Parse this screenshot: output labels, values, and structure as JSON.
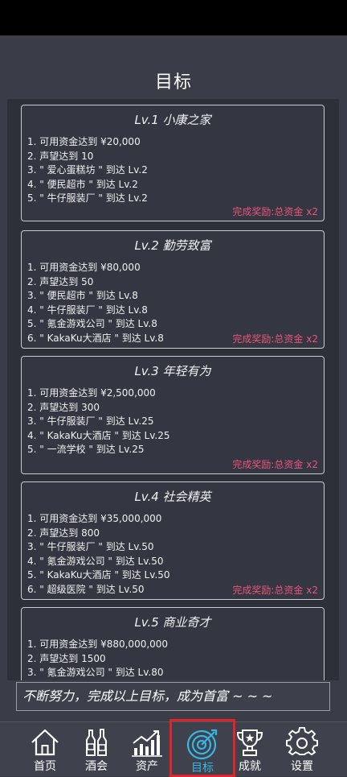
{
  "page_title": "目标",
  "goals": [
    {
      "title": "Lv.1 小康之家",
      "requirements": [
        "1. 可用资金达到 ¥20,000",
        "2. 声望达到 10",
        "3. \" 爱心蛋糕坊 \" 到达 Lv.2",
        "4. \" 便民超市 \" 到达 Lv.2",
        "5. \" 牛仔服装厂 \" 到达 Lv.2"
      ],
      "reward": "完成奖励:总资金 x2"
    },
    {
      "title": "Lv.2 勤劳致富",
      "requirements": [
        "1. 可用资金达到 ¥80,000",
        "2. 声望达到 50",
        "3. \" 便民超市 \" 到达 Lv.8",
        "4. \" 牛仔服装厂 \" 到达 Lv.8",
        "5. \" 氪金游戏公司 \" 到达 Lv.8",
        "6. \" KakaKu大酒店 \" 到达 Lv.8"
      ],
      "reward": "完成奖励:总资金 x2"
    },
    {
      "title": "Lv.3 年轻有为",
      "requirements": [
        "1. 可用资金达到 ¥2,500,000",
        "2. 声望达到 300",
        "3. \" 牛仔服装厂 \" 到达 Lv.25",
        "4. \" KakaKu大酒店 \" 到达 Lv.25",
        "5. \" 一流学校 \" 到达 Lv.25"
      ],
      "reward": "完成奖励:总资金 x2"
    },
    {
      "title": "Lv.4 社会精英",
      "requirements": [
        "1. 可用资金达到 ¥35,000,000",
        "2. 声望达到 800",
        "3. \" 牛仔服装厂 \" 到达 Lv.50",
        "4. \" 氪金游戏公司 \" 到达 Lv.50",
        "5. \" KakaKu大酒店 \" 到达 Lv.50",
        "6. \" 超级医院 \" 到达 Lv.50"
      ],
      "reward": "完成奖励:总资金 x2"
    },
    {
      "title": "Lv.5 商业奇才",
      "requirements": [
        "1. 可用资金达到 ¥880,000,000",
        "2. 声望达到 1500",
        "3. \" 氪金游戏公司 \" 到达 Lv.80"
      ],
      "reward": ""
    }
  ],
  "footer_note": "不断努力，完成以上目标，成为首富 ~ ~ ~",
  "tabs": [
    {
      "label": "首页",
      "icon": "home-icon"
    },
    {
      "label": "酒会",
      "icon": "wine-bottles-icon"
    },
    {
      "label": "资产",
      "icon": "bar-chart-icon"
    },
    {
      "label": "目标",
      "icon": "target-icon",
      "active": true
    },
    {
      "label": "成就",
      "icon": "trophy-icon"
    },
    {
      "label": "设置",
      "icon": "gear-icon"
    }
  ],
  "colors": {
    "accent": "#35b7e6",
    "reward": "#e8567a",
    "active_border": "#e0242c"
  }
}
